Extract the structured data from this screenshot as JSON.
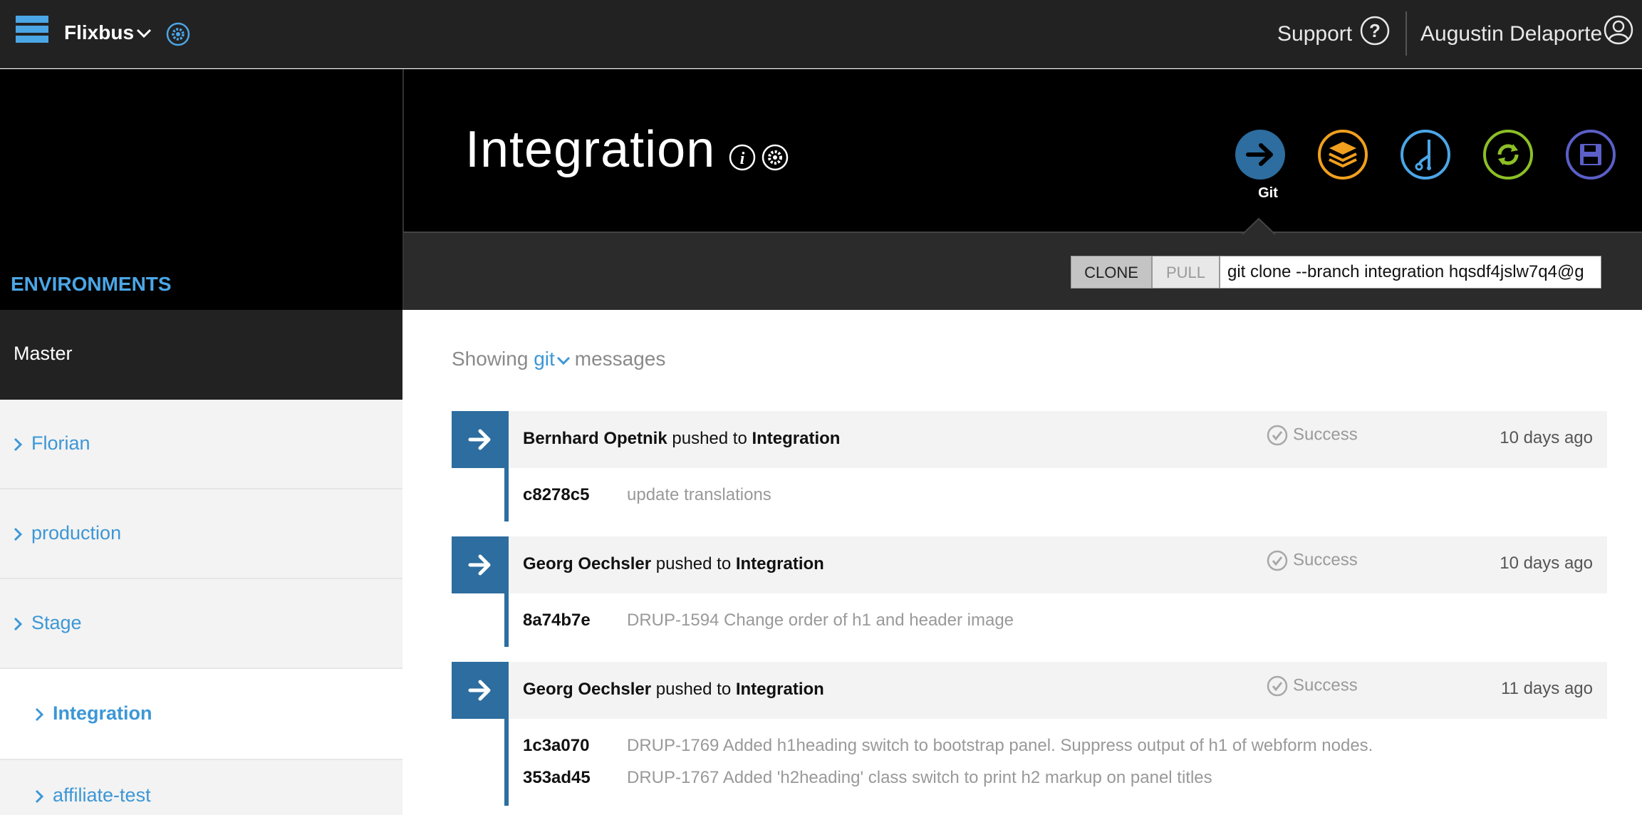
{
  "topbar": {
    "project": "Flixbus",
    "support": "Support",
    "user": "Augustin Delaporte"
  },
  "sidebar": {
    "title": "ENVIRONMENTS",
    "items": [
      {
        "label": "Master",
        "state": "parent"
      },
      {
        "label": "Florian",
        "state": "normal"
      },
      {
        "label": "production",
        "state": "normal"
      },
      {
        "label": "Stage",
        "state": "normal"
      },
      {
        "label": "Integration",
        "state": "active"
      },
      {
        "label": "affiliate-test",
        "state": "normal"
      }
    ]
  },
  "header": {
    "environment": "Integration",
    "actions": [
      {
        "icon": "git-arrow-icon",
        "label": "Git",
        "color": "#2d6d9f"
      },
      {
        "icon": "layers-icon",
        "color": "#f0a01e"
      },
      {
        "icon": "branch-icon",
        "color": "#4ba6e6"
      },
      {
        "icon": "sync-icon",
        "color": "#8cbf26"
      },
      {
        "icon": "save-icon",
        "color": "#5b5fc7"
      }
    ]
  },
  "clone": {
    "clone_label": "CLONE",
    "pull_label": "PULL",
    "command": "git clone --branch integration hqsdf4jslw7q4@g"
  },
  "messages": {
    "prefix": "Showing",
    "filter": "git",
    "suffix": "messages",
    "entries": [
      {
        "author": "Bernhard Opetnik",
        "action": "pushed to",
        "target": "Integration",
        "status": "Success",
        "time": "10 days ago",
        "commits": [
          {
            "hash": "c8278c5",
            "message": "update translations"
          }
        ]
      },
      {
        "author": "Georg Oechsler",
        "action": "pushed to",
        "target": "Integration",
        "status": "Success",
        "time": "10 days ago",
        "commits": [
          {
            "hash": "8a74b7e",
            "message": "DRUP-1594 Change order of h1 and header image"
          }
        ]
      },
      {
        "author": "Georg Oechsler",
        "action": "pushed to",
        "target": "Integration",
        "status": "Success",
        "time": "11 days ago",
        "commits": [
          {
            "hash": "1c3a070",
            "message": "DRUP-1769 Added h1heading switch to bootstrap panel. Suppress output of h1 of webform nodes."
          },
          {
            "hash": "353ad45",
            "message": "DRUP-1767 Added 'h2heading' class switch to print h2 markup on panel titles"
          }
        ]
      }
    ]
  },
  "colors": {
    "accent": "#4ba6e6",
    "entry_arrow": "#2d6d9f",
    "topbar": "#222222"
  }
}
